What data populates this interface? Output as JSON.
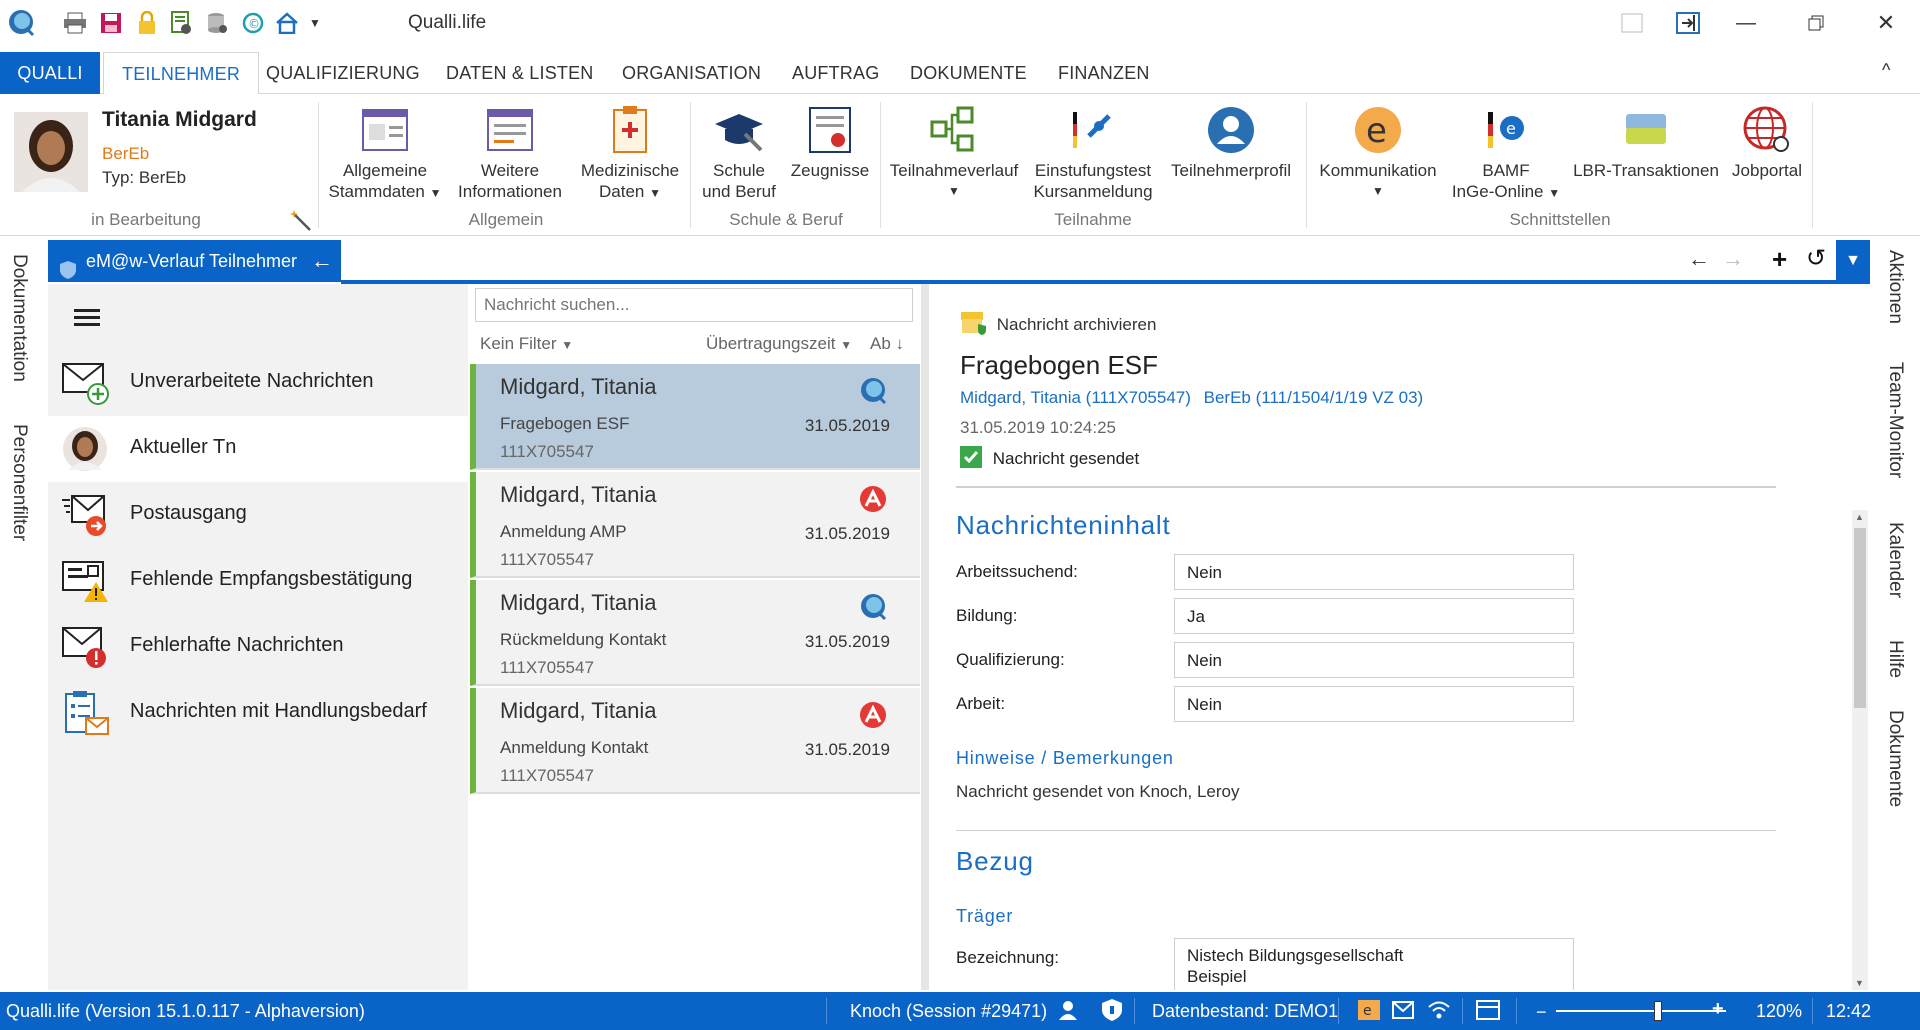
{
  "app": {
    "title": "Qualli.life"
  },
  "tabs": [
    "QUALLI",
    "TEILNEHMER",
    "QUALIFIZIERUNG",
    "DATEN & LISTEN",
    "ORGANISATION",
    "AUFTRAG",
    "DOKUMENTE",
    "FINANZEN"
  ],
  "participant": {
    "name": "Titania Midgard",
    "org": "BerEb",
    "type": "Typ: BerEb",
    "state": "in Bearbeitung"
  },
  "ribbon": {
    "allgemein": {
      "label": "Allgemein",
      "buttons": [
        {
          "l1": "Allgemeine",
          "l2": "Stammdaten"
        },
        {
          "l1": "Weitere",
          "l2": "Informationen"
        },
        {
          "l1": "Medizinische",
          "l2": "Daten"
        }
      ]
    },
    "schule": {
      "label": "Schule & Beruf",
      "buttons": [
        {
          "l1": "Schule",
          "l2": "und Beruf"
        },
        {
          "l1": "Zeugnisse",
          "l2": ""
        }
      ]
    },
    "teilnahme": {
      "label": "Teilnahme",
      "buttons": [
        {
          "l1": "Teilnahmeverlauf",
          "l2": ""
        },
        {
          "l1": "Einstufungstest",
          "l2": "Kursanmeldung"
        },
        {
          "l1": "Teilnehmerprofil",
          "l2": ""
        }
      ]
    },
    "schnitt": {
      "label": "Schnittstellen",
      "buttons": [
        {
          "l1": "Kommunikation",
          "l2": ""
        },
        {
          "l1": "BAMF",
          "l2": "InGe-Online"
        },
        {
          "l1": "LBR-Transaktionen",
          "l2": ""
        },
        {
          "l1": "Jobportal",
          "l2": ""
        }
      ]
    }
  },
  "left_bar": [
    "Dokumentation",
    "Personenfilter"
  ],
  "right_bar": [
    "Aktionen",
    "Team-Monitor",
    "Kalender",
    "Hilfe",
    "Dokumente"
  ],
  "module": {
    "title": "eM@w-Verlauf Teilnehmer"
  },
  "nav": [
    "Unverarbeitete Nachrichten",
    "Aktueller Tn",
    "Postausgang",
    "Fehlende Empfangsbestätigung",
    "Fehlerhafte Nachrichten",
    "Nachrichten mit Handlungsbedarf"
  ],
  "list": {
    "search_placeholder": "Nachricht suchen...",
    "filter": "Kein Filter",
    "sort": "Übertragungszeit",
    "order": "Ab",
    "messages": [
      {
        "name": "Midgard, Titania",
        "subject": "Fragebogen ESF",
        "date": "31.05.2019",
        "code": "111X705547",
        "badge": "qualli-icon"
      },
      {
        "name": "Midgard, Titania",
        "subject": "Anmeldung AMP",
        "date": "31.05.2019",
        "code": "111X705547",
        "badge": "agentur-icon"
      },
      {
        "name": "Midgard, Titania",
        "subject": "Rückmeldung Kontakt",
        "date": "31.05.2019",
        "code": "111X705547",
        "badge": "qualli-icon"
      },
      {
        "name": "Midgard, Titania",
        "subject": "Anmeldung Kontakt",
        "date": "31.05.2019",
        "code": "111X705547",
        "badge": "agentur-icon"
      }
    ]
  },
  "detail": {
    "archive": "Nachricht archivieren",
    "title": "Fragebogen ESF",
    "link1": "Midgard, Titania (111X705547)",
    "link2": "BerEb (111/1504/1/19 VZ 03)",
    "timestamp": "31.05.2019 10:24:25",
    "sent": "Nachricht gesendet",
    "h_inhalt": "Nachrichteninhalt",
    "fields": [
      {
        "label": "Arbeitssuchend:",
        "value": "Nein"
      },
      {
        "label": "Bildung:",
        "value": "Ja"
      },
      {
        "label": "Qualifizierung:",
        "value": "Nein"
      },
      {
        "label": "Arbeit:",
        "value": "Nein"
      }
    ],
    "h_hinweise": "Hinweise / Bemerkungen",
    "hinweis_text": "Nachricht gesendet von Knoch, Leroy",
    "h_bezug": "Bezug",
    "h_traeger": "Träger",
    "bez_label": "Bezeichnung:",
    "bez_line1": "Nistech Bildungsgesellschaft",
    "bez_line2": "Beispiel"
  },
  "status": {
    "version": "Qualli.life (Version 15.1.0.117 - Alphaversion)",
    "session": "Knoch (Session #29471)",
    "datenbestand": "Datenbestand: DEMO1",
    "zoom": "120%",
    "time": "12:42",
    "zoom_level": 0.6
  },
  "colors": {
    "accent": "#0a64c8",
    "link": "#1a6fc4",
    "green": "#6cb43f"
  }
}
